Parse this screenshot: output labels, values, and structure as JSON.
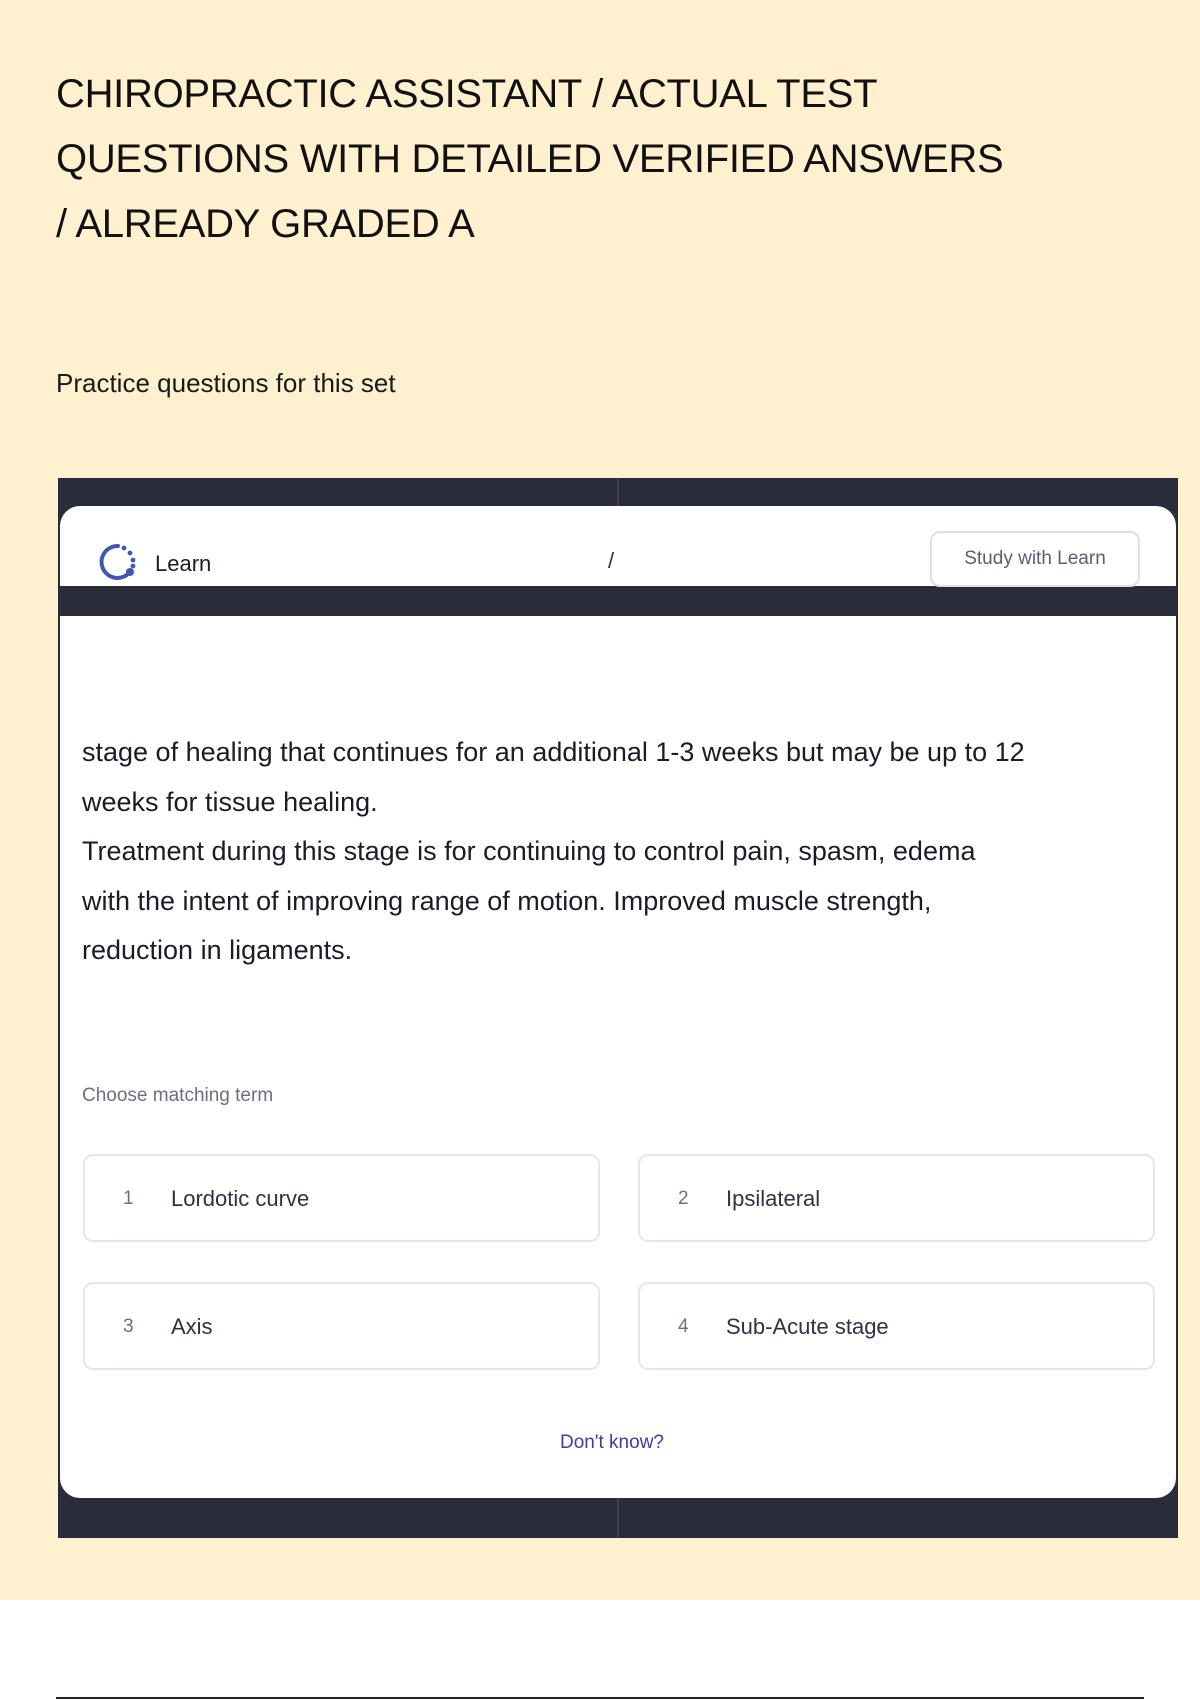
{
  "document": {
    "title_lines": [
      "CHIROPRACTIC ASSISTANT / ACTUAL TEST",
      "QUESTIONS WITH DETAILED VERIFIED ANSWERS",
      "/ ALREADY GRADED A"
    ],
    "subtitle": "Practice questions for this set"
  },
  "learn_widget": {
    "mode_label": "Learn",
    "mode_icon": "learn-icon",
    "progress_separator": "/",
    "study_button_label": "Study with Learn",
    "definition_lines": [
      "stage of healing that continues for an additional 1-3 weeks but may be up to 12",
      "weeks for tissue healing.",
      "Treatment during this stage is for continuing to control pain, spasm, edema",
      "with the intent of improving range of motion. Improved muscle strength,",
      "reduction in ligaments."
    ],
    "prompt_label": "Choose matching term",
    "options": [
      {
        "number": "1",
        "term": "Lordotic curve"
      },
      {
        "number": "2",
        "term": "Ipsilateral"
      },
      {
        "number": "3",
        "term": "Axis"
      },
      {
        "number": "4",
        "term": "Sub-Acute stage"
      }
    ],
    "dont_know_label": "Don't know?"
  },
  "colors": {
    "page_background": "#fff1d0",
    "frame": "#2a2c3b",
    "accent": "#4257b2",
    "link": "#3a3f9a"
  }
}
